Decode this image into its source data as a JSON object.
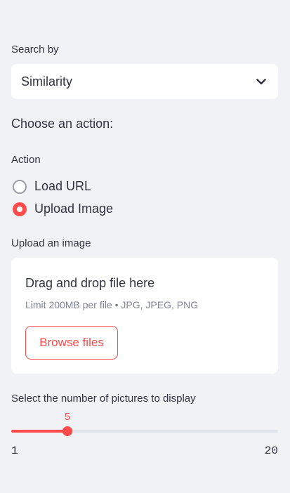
{
  "search_by": {
    "label": "Search by",
    "selected": "Similarity",
    "icon": "chevron-down-icon"
  },
  "action_heading": "Choose an action:",
  "action": {
    "label": "Action",
    "options": [
      {
        "label": "Load URL",
        "selected": false
      },
      {
        "label": "Upload Image",
        "selected": true
      }
    ]
  },
  "upload": {
    "label": "Upload an image",
    "drop_text": "Drag and drop file here",
    "limit_text": "Limit 200MB per file • JPG, JPEG, PNG",
    "browse_label": "Browse files"
  },
  "slider": {
    "label": "Select the number of pictures to display",
    "value": 5,
    "min": 1,
    "max": 20,
    "value_text": "5",
    "min_text": "1",
    "max_text": "20"
  },
  "colors": {
    "accent": "#ff4b4b",
    "background": "#f0f2f6",
    "text": "#31333f"
  }
}
